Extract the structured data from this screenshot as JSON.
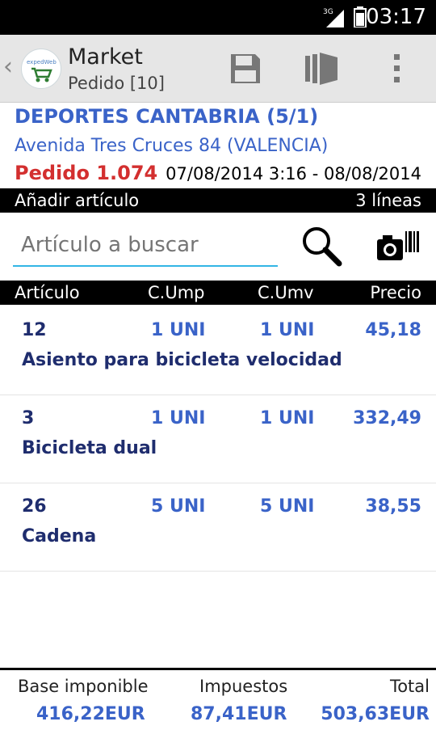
{
  "status": {
    "network": "3G",
    "time": "03:17"
  },
  "actionbar": {
    "title": "Market",
    "subtitle": "Pedido [10]",
    "logo_text": "expedWeb"
  },
  "order_header": {
    "customer": "DEPORTES CANTABRIA (5/1)",
    "address": "Avenida Tres Cruces 84 (VALENCIA)",
    "order_number": "Pedido 1.074",
    "dates": "07/08/2014 3:16 - 08/08/2014"
  },
  "add_bar": {
    "label": "Añadir artículo",
    "lines": "3 líneas"
  },
  "search": {
    "placeholder": "Artículo a buscar",
    "value": ""
  },
  "table": {
    "headers": [
      "Artículo",
      "C.Ump",
      "C.Umv",
      "Precio"
    ],
    "rows": [
      {
        "code": "12",
        "ump": "1 UNI",
        "umv": "1 UNI",
        "price": "45,18",
        "description": "Asiento para bicicleta velocidad"
      },
      {
        "code": "3",
        "ump": "1 UNI",
        "umv": "1 UNI",
        "price": "332,49",
        "description": "Bicicleta dual"
      },
      {
        "code": "26",
        "ump": "5 UNI",
        "umv": "5 UNI",
        "price": "38,55",
        "description": "Cadena"
      }
    ]
  },
  "totals": {
    "base_label": "Base imponible",
    "base_value": "416,22EUR",
    "tax_label": "Impuestos",
    "tax_value": "87,41EUR",
    "total_label": "Total",
    "total_value": "503,63EUR"
  },
  "colors": {
    "link_blue": "#3a63c8",
    "dark_blue": "#1f2d6e",
    "order_red": "#d32f2f",
    "accent": "#33b5e5"
  }
}
